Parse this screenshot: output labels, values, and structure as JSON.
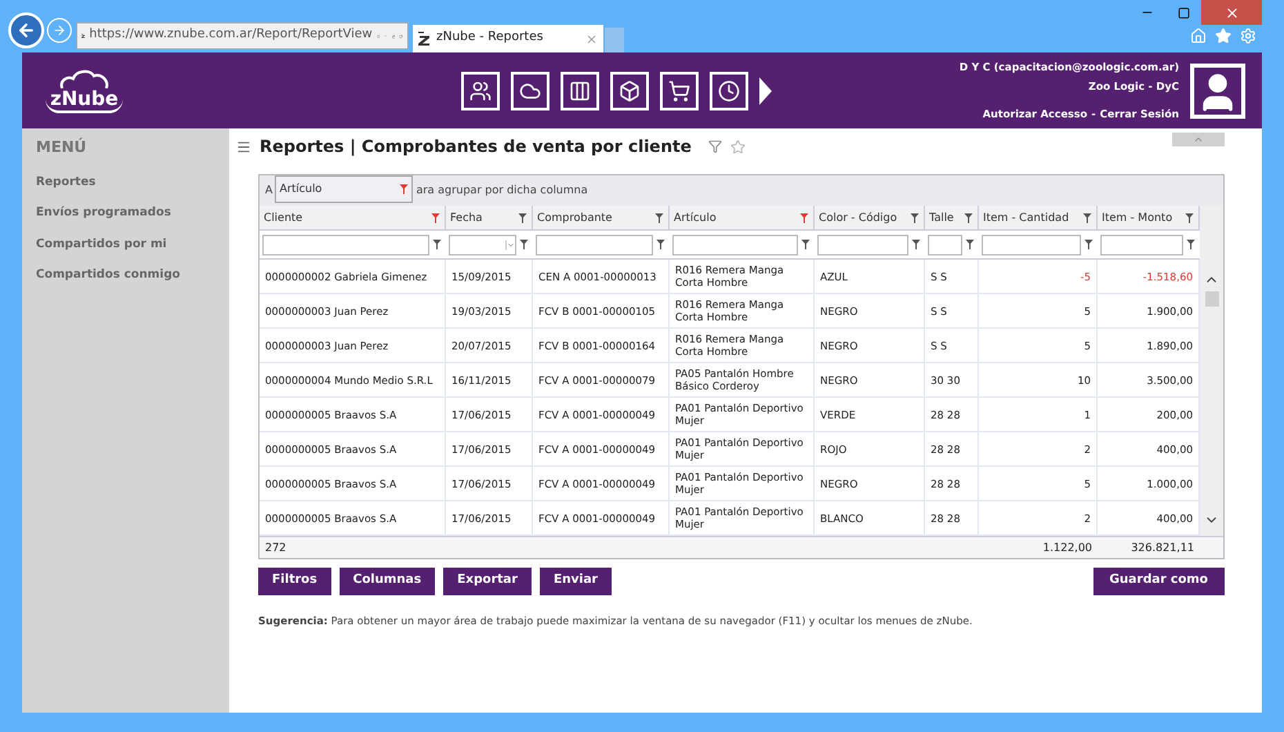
{
  "browser": {
    "url": "https://www.znube.com.ar/Report/ReportView",
    "tab_title": "zNube - Reportes"
  },
  "header": {
    "logo": "zNube",
    "user": "D Y C (capacitacion@zoologic.com.ar)",
    "company": "Zoo Logic - DyC",
    "links": [
      "Autorizar Accesso",
      "Cerrar Sesión"
    ],
    "link_separator": "-"
  },
  "sidebar": {
    "title": "MENÚ",
    "items": [
      "Reportes",
      "Envíos programados",
      "Compartidos por mi",
      "Compartidos conmigo"
    ]
  },
  "page": {
    "title": "Reportes | Comprobantes de venta por cliente"
  },
  "group_panel": {
    "hint_start": "A",
    "hint_end": "ara agrupar por dicha columna",
    "dragged_column": "Artículo"
  },
  "table": {
    "columns": [
      {
        "label": "Cliente",
        "filtered": true,
        "kind": "text"
      },
      {
        "label": "Fecha",
        "filtered": false,
        "kind": "date"
      },
      {
        "label": "Comprobante",
        "filtered": false,
        "kind": "text"
      },
      {
        "label": "Artículo",
        "filtered": true,
        "kind": "text"
      },
      {
        "label": "Color - Código",
        "filtered": false,
        "kind": "text"
      },
      {
        "label": "Talle",
        "filtered": false,
        "kind": "text"
      },
      {
        "label": "Item - Cantidad",
        "filtered": false,
        "kind": "number"
      },
      {
        "label": "Item - Monto",
        "filtered": false,
        "kind": "number"
      }
    ],
    "rows": [
      {
        "negative": true,
        "cells": [
          "0000000002 Gabriela Gimenez",
          "15/09/2015",
          "CEN A 0001-00000013",
          "R016 Remera Manga Corta Hombre",
          "AZUL",
          "S S",
          "-5",
          "-1.518,60"
        ]
      },
      {
        "negative": false,
        "cells": [
          "0000000003 Juan Perez",
          "19/03/2015",
          "FCV B 0001-00000105",
          "R016 Remera Manga Corta Hombre",
          "NEGRO",
          "S S",
          "5",
          "1.900,00"
        ]
      },
      {
        "negative": false,
        "cells": [
          "0000000003 Juan Perez",
          "20/07/2015",
          "FCV B 0001-00000164",
          "R016 Remera Manga Corta Hombre",
          "NEGRO",
          "S S",
          "5",
          "1.890,00"
        ]
      },
      {
        "negative": false,
        "cells": [
          "0000000004 Mundo Medio S.R.L",
          "16/11/2015",
          "FCV A 0001-00000079",
          "PA05 Pantalón Hombre Básico Corderoy",
          "NEGRO",
          "30 30",
          "10",
          "3.500,00"
        ]
      },
      {
        "negative": false,
        "cells": [
          "0000000005 Braavos S.A",
          "17/06/2015",
          "FCV A 0001-00000049",
          "PA01 Pantalón Deportivo Mujer",
          "VERDE",
          "28 28",
          "1",
          "200,00"
        ]
      },
      {
        "negative": false,
        "cells": [
          "0000000005 Braavos S.A",
          "17/06/2015",
          "FCV A 0001-00000049",
          "PA01 Pantalón Deportivo Mujer",
          "ROJO",
          "28 28",
          "2",
          "400,00"
        ]
      },
      {
        "negative": false,
        "cells": [
          "0000000005 Braavos S.A",
          "17/06/2015",
          "FCV A 0001-00000049",
          "PA01 Pantalón Deportivo Mujer",
          "NEGRO",
          "28 28",
          "5",
          "1.000,00"
        ]
      },
      {
        "negative": false,
        "cells": [
          "0000000005 Braavos S.A",
          "17/06/2015",
          "FCV A 0001-00000049",
          "PA01 Pantalón Deportivo Mujer",
          "BLANCO",
          "28 28",
          "2",
          "400,00"
        ]
      }
    ],
    "footer": {
      "count": "272",
      "quantity_total": "1.122,00",
      "amount_total": "326.821,11"
    }
  },
  "buttons": [
    "Filtros",
    "Columnas",
    "Exportar",
    "Enviar"
  ],
  "save_button": "Guardar como",
  "tip": "**Sugerencia:** Para obtener un mayor área de trabajo puede maximizar la ventana de su navegador (F11) y ocultar los menues de zNube."
}
